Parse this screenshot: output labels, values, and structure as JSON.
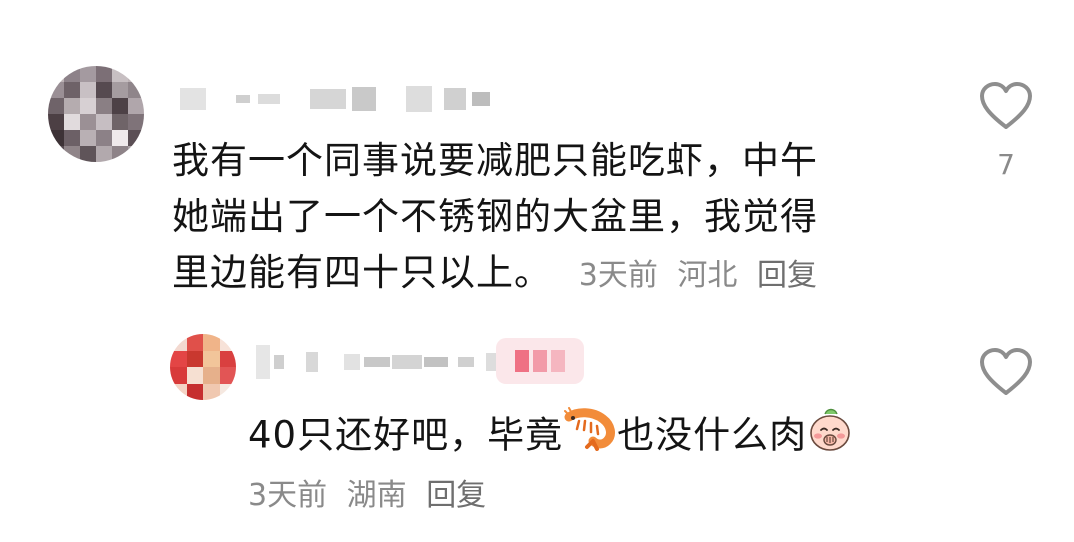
{
  "comments": [
    {
      "text_lines": [
        "我有一个同事说要减肥只能吃虾，中午",
        "她端出了一个不锈钢的大盆里，我觉得",
        "里边能有四十只以上。"
      ],
      "time": "3天前",
      "location": "河北",
      "reply_label": "回复",
      "like_count": "7"
    },
    {
      "text_before": "40只还好吧，毕竟",
      "text_after": "也没什么肉",
      "time": "3天前",
      "location": "湖南",
      "reply_label": "回复",
      "like_count": ""
    }
  ],
  "icons": {
    "like": "heart-outline-icon",
    "shrimp": "shrimp-emoji-icon",
    "peach": "peach-face-emoji-icon"
  },
  "colors": {
    "meta_text": "#8a8a8a",
    "heart_stroke": "#8e8e8e",
    "shrimp": "#f28c3a"
  }
}
